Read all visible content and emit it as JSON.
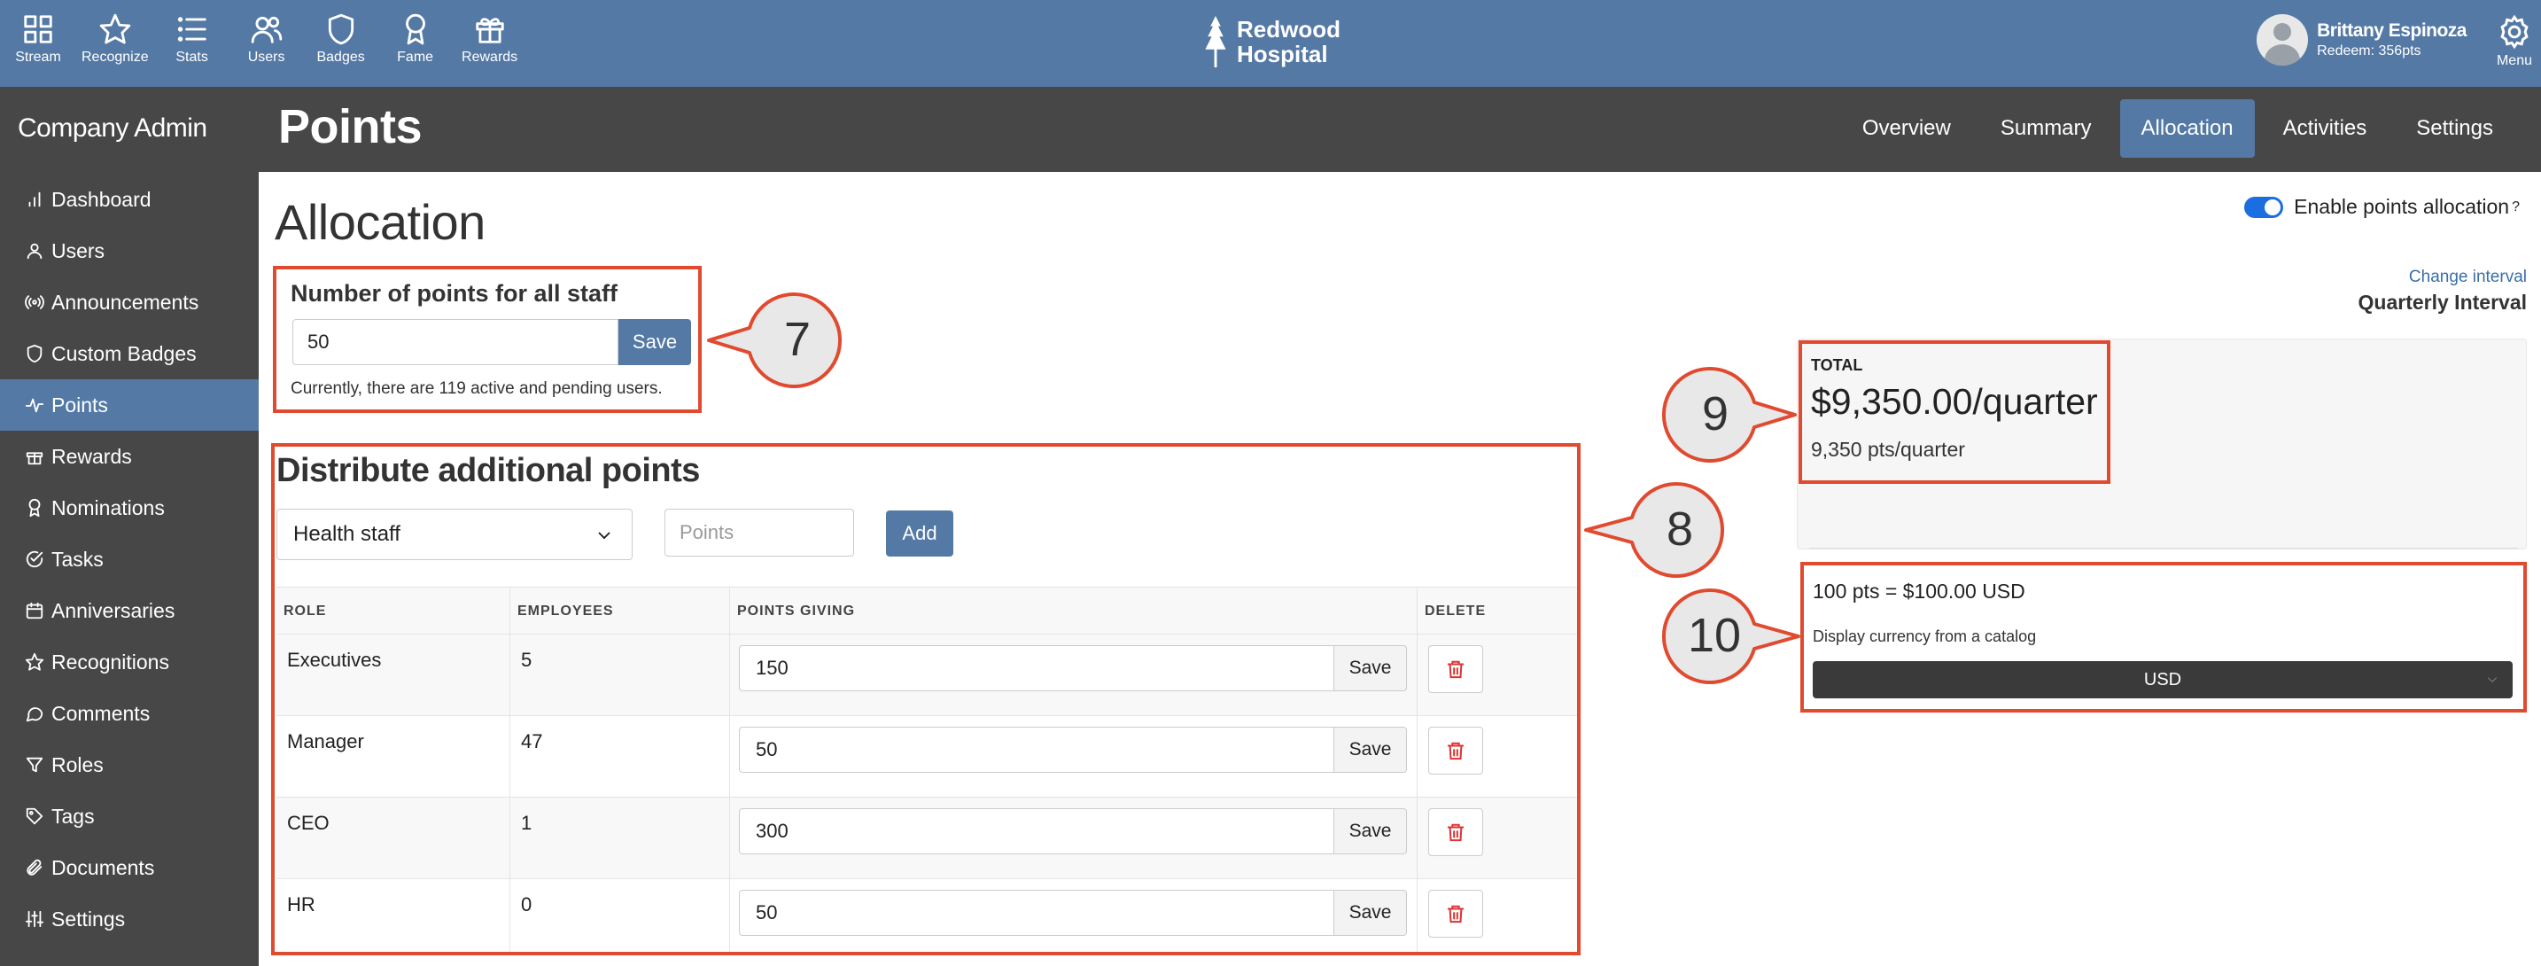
{
  "topnav": [
    {
      "label": "Stream",
      "icon": "grid-icon"
    },
    {
      "label": "Recognize",
      "icon": "star-icon"
    },
    {
      "label": "Stats",
      "icon": "list-icon"
    },
    {
      "label": "Users",
      "icon": "users-icon"
    },
    {
      "label": "Badges",
      "icon": "shield-icon"
    },
    {
      "label": "Fame",
      "icon": "award-icon"
    },
    {
      "label": "Rewards",
      "icon": "gift-icon"
    }
  ],
  "brand": {
    "line1": "Redwood",
    "line2": "Hospital",
    "icon": "tree-icon"
  },
  "user": {
    "name": "Brittany Espinoza",
    "redeem": "Redeem: 356pts"
  },
  "menu_label": "Menu",
  "sidebar": {
    "title": "Company Admin",
    "items": [
      {
        "label": "Dashboard",
        "icon": "bar-chart-icon"
      },
      {
        "label": "Users",
        "icon": "user-icon"
      },
      {
        "label": "Announcements",
        "icon": "broadcast-icon"
      },
      {
        "label": "Custom Badges",
        "icon": "shield-icon"
      },
      {
        "label": "Points",
        "icon": "activity-icon",
        "active": true
      },
      {
        "label": "Rewards",
        "icon": "gift-icon"
      },
      {
        "label": "Nominations",
        "icon": "award-icon"
      },
      {
        "label": "Tasks",
        "icon": "check-circle-icon"
      },
      {
        "label": "Anniversaries",
        "icon": "calendar-icon"
      },
      {
        "label": "Recognitions",
        "icon": "star-icon"
      },
      {
        "label": "Comments",
        "icon": "comment-icon"
      },
      {
        "label": "Roles",
        "icon": "filter-icon"
      },
      {
        "label": "Tags",
        "icon": "tag-icon"
      },
      {
        "label": "Documents",
        "icon": "paperclip-icon"
      },
      {
        "label": "Settings",
        "icon": "sliders-icon"
      }
    ]
  },
  "header": {
    "title": "Points",
    "tabs": [
      {
        "label": "Overview"
      },
      {
        "label": "Summary"
      },
      {
        "label": "Allocation",
        "active": true
      },
      {
        "label": "Activities"
      },
      {
        "label": "Settings"
      }
    ]
  },
  "allocation": {
    "title": "Allocation",
    "all_staff": {
      "heading": "Number of points for all staff",
      "value": "50",
      "save_label": "Save",
      "note": "Currently, there are 119 active and pending users."
    },
    "distribute": {
      "heading": "Distribute additional points",
      "selected_role": "Health staff",
      "points_placeholder": "Points",
      "add_label": "Add",
      "columns": [
        "ROLE",
        "EMPLOYEES",
        "POINTS GIVING",
        "DELETE"
      ],
      "rows": [
        {
          "role": "Executives",
          "employees": "5",
          "points": "150"
        },
        {
          "role": "Manager",
          "employees": "47",
          "points": "50"
        },
        {
          "role": "CEO",
          "employees": "1",
          "points": "300"
        },
        {
          "role": "HR",
          "employees": "0",
          "points": "50"
        }
      ],
      "row_save_label": "Save"
    }
  },
  "right_panel": {
    "toggle_label": "Enable points allocation",
    "toggle_help": "?",
    "toggle_on": true,
    "change_interval": "Change interval",
    "interval": "Quarterly Interval",
    "total_label": "TOTAL",
    "total_amount": "$9,350.00/quarter",
    "total_points": "9,350 pts/quarter",
    "rate": "100 pts = $100.00 USD",
    "display_currency_label": "Display currency from a catalog",
    "currency": "USD"
  },
  "callouts": [
    "7",
    "8",
    "9",
    "10"
  ],
  "colors": {
    "brand": "#5479a5",
    "sidebar": "#474747",
    "highlight": "#e04a2f",
    "toggle": "#1a6ee0",
    "delete": "#dd3333"
  }
}
